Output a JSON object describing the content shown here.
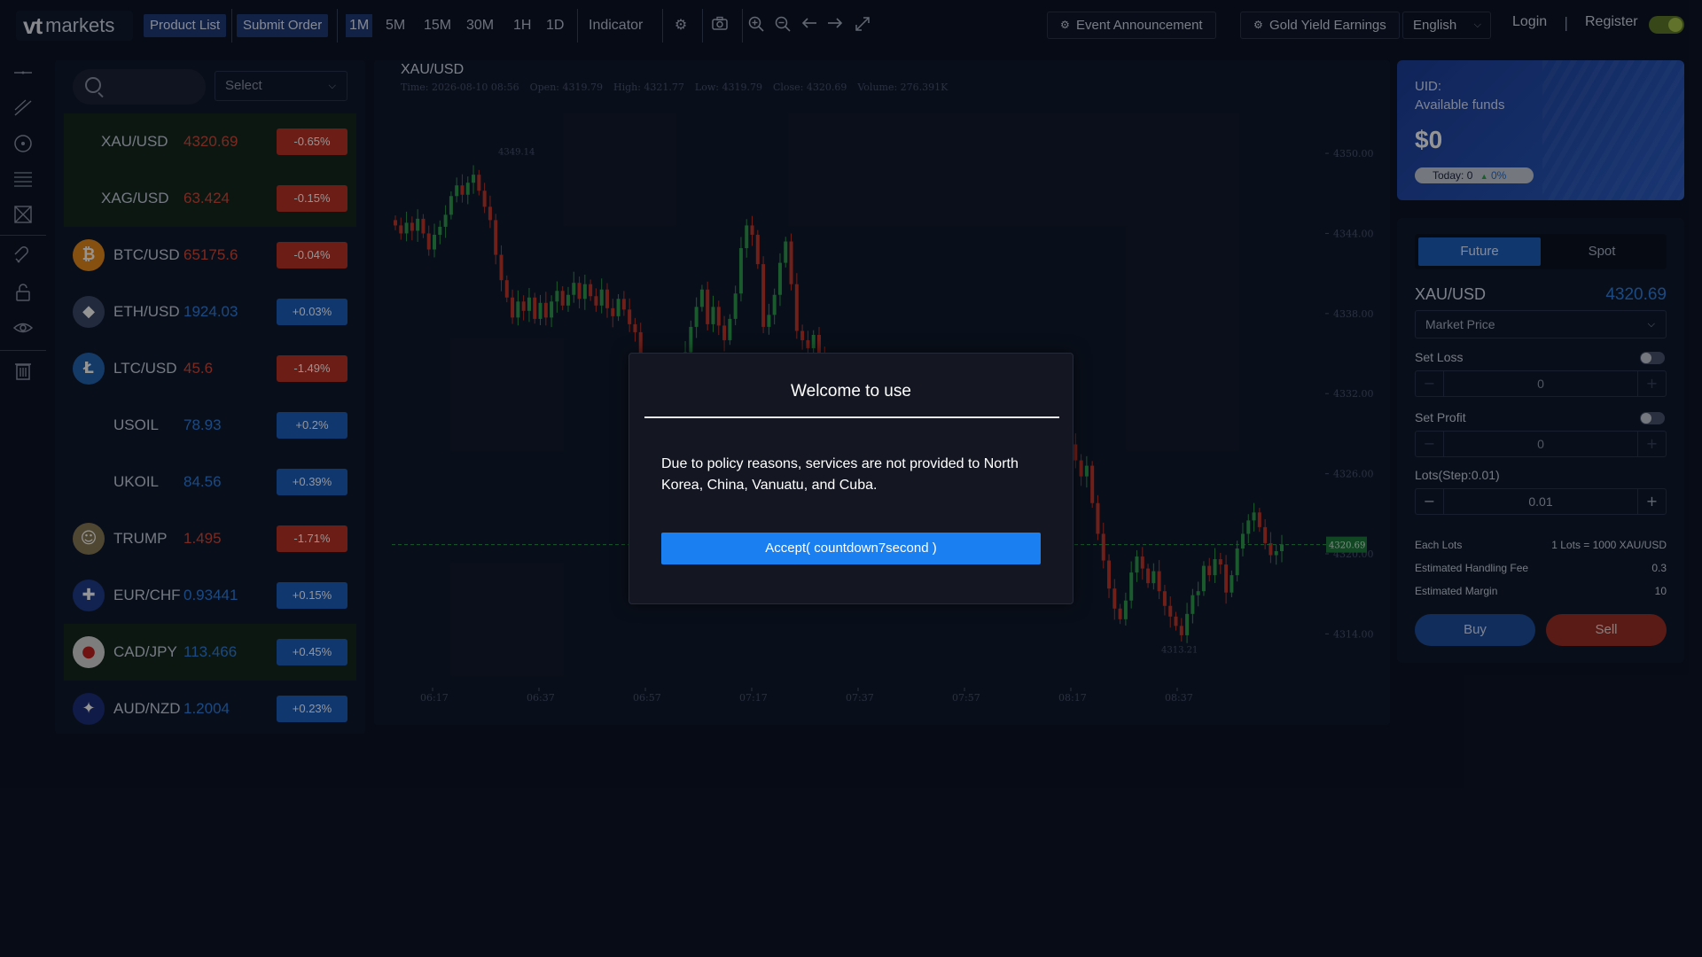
{
  "topbar": {
    "logo_vt": "vt",
    "logo_markets": "markets",
    "product_list": "Product List",
    "submit_order": "Submit Order",
    "timeframes": [
      "1M",
      "5M",
      "15M",
      "30M",
      "1H",
      "1D"
    ],
    "indicator": "Indicator",
    "event_announcement": "Event Announcement",
    "gold_yield": "Gold Yield Earnings",
    "language": "English",
    "login": "Login",
    "separator": "|",
    "register": "Register"
  },
  "product_list": {
    "search_placeholder": "",
    "select_label": "Select",
    "items": [
      {
        "symbol": "XAU/USD",
        "price": "4320.69",
        "change": "-0.65%",
        "dir": "down",
        "icon": "",
        "highlight": true
      },
      {
        "symbol": "XAG/USD",
        "price": "63.424",
        "change": "-0.15%",
        "dir": "down",
        "icon": "",
        "highlight": true
      },
      {
        "symbol": "BTC/USD",
        "price": "65175.6",
        "change": "-0.04%",
        "dir": "down",
        "icon": "bitcoin-icon",
        "highlight": false
      },
      {
        "symbol": "ETH/USD",
        "price": "1924.03",
        "change": "+0.03%",
        "dir": "up",
        "icon": "ethereum-icon",
        "highlight": false
      },
      {
        "symbol": "LTC/USD",
        "price": "45.6",
        "change": "-1.49%",
        "dir": "down",
        "icon": "litecoin-icon",
        "highlight": false
      },
      {
        "symbol": "USOIL",
        "price": "78.93",
        "change": "+0.2%",
        "dir": "up",
        "icon": "",
        "highlight": false
      },
      {
        "symbol": "UKOIL",
        "price": "84.56",
        "change": "+0.39%",
        "dir": "up",
        "icon": "",
        "highlight": false
      },
      {
        "symbol": "TRUMP",
        "price": "1.495",
        "change": "-1.71%",
        "dir": "down",
        "icon": "trump-coin-icon",
        "highlight": false
      },
      {
        "symbol": "EUR/CHF",
        "price": "0.93441",
        "change": "+0.15%",
        "dir": "up",
        "icon": "eur-chf-flag-icon",
        "highlight": false
      },
      {
        "symbol": "CAD/JPY",
        "price": "113.466",
        "change": "+0.45%",
        "dir": "up",
        "icon": "cad-jpy-flag-icon",
        "highlight": true
      },
      {
        "symbol": "AUD/NZD",
        "price": "1.2004",
        "change": "+0.23%",
        "dir": "up",
        "icon": "aud-nzd-flag-icon",
        "highlight": false
      }
    ]
  },
  "chart": {
    "title": "XAU/USD",
    "time": "Time: 2026-08-10 08:56",
    "open": "Open: 4319.79",
    "high": "High: 4321.77",
    "low": "Low: 4319.79",
    "close": "Close: 4320.69",
    "volume": "Volume: 276.391K",
    "current_price_label": "4320.69",
    "max_label": "4349.14",
    "min_label": "4313.21"
  },
  "chart_data": {
    "type": "candlestick",
    "title": "XAU/USD",
    "y_ticks": [
      "4350.00",
      "4344.00",
      "4338.00",
      "4332.00",
      "4326.00",
      "4320.00",
      "4314.00"
    ],
    "x_ticks": [
      "06:17",
      "06:37",
      "06:57",
      "07:17",
      "07:37",
      "07:57",
      "08:17",
      "08:37"
    ],
    "ylim": [
      4312.5,
      4351
    ],
    "current": 4320.69,
    "close_path": [
      4344.6,
      4344.0,
      4344.8,
      4344.2,
      4345.1,
      4344.0,
      4342.8,
      4343.9,
      4344.5,
      4345.4,
      4346.8,
      4347.6,
      4346.9,
      4347.8,
      4348.4,
      4347.2,
      4346.0,
      4345.0,
      4342.4,
      4340.5,
      4339.2,
      4337.7,
      4338.9,
      4338.2,
      4339.2,
      4337.6,
      4338.8,
      4337.7,
      4338.9,
      4339.7,
      4338.6,
      4339.4,
      4340.3,
      4339.1,
      4340.2,
      4339.3,
      4338.6,
      4339.8,
      4338.4,
      4337.8,
      4339.1,
      4338.3,
      4337.2,
      4336.6,
      4333.1,
      4330.0,
      4327.4,
      4326.2,
      4327.6,
      4330.2,
      4332.8,
      4334.0,
      4335.1,
      4337.0,
      4338.5,
      4339.8,
      4337.2,
      4338.5,
      4337.1,
      4336.0,
      4337.6,
      4339.5,
      4342.9,
      4344.6,
      4343.9,
      4341.7,
      4337.0,
      4337.9,
      4339.4,
      4341.8,
      4343.4,
      4340.2,
      4336.7,
      4336.0,
      4335.4,
      4336.4,
      4334.7,
      4333.6,
      4332.8,
      4333.9,
      4333.2,
      4332.5,
      4330.9,
      4331.7,
      4330.0,
      4331.2,
      4331.0,
      4329.9,
      4330.9,
      4330.1,
      4331.7,
      4331.4,
      4330.3,
      4330.2,
      4330.6,
      4331.2,
      4330.7,
      4330.6,
      4331.9,
      4331.8,
      4330.3,
      4331.5,
      4332.5,
      4331.7,
      4330.6,
      4329.1,
      4327.7,
      4326.0,
      4325.4,
      4323.9,
      4322.3,
      4321.7,
      4323.2,
      4324.5,
      4322.9,
      4321.8,
      4322.8,
      4323.2,
      4324.2,
      4325.9,
      4327.6,
      4328.2,
      4327.0,
      4325.8,
      4326.6,
      4323.8,
      4321.5,
      4319.5,
      4317.4,
      4315.9,
      4315.1,
      4316.5,
      4318.6,
      4319.8,
      4318.9,
      4317.8,
      4318.7,
      4317.2,
      4316.1,
      4315.3,
      4314.6,
      4313.9,
      4315.5,
      4316.9,
      4317.2,
      4319.1,
      4318.4,
      4319.6,
      4319.2,
      4317.1,
      4318.4,
      4320.4,
      4321.5,
      4322.5,
      4323.1,
      4322.0,
      4320.8,
      4319.9,
      4320.2,
      4320.7
    ]
  },
  "account": {
    "uid_label": "UID:",
    "available_funds": "Available funds",
    "balance": "$0",
    "today_label": "Today: 0",
    "today_pct": "0%"
  },
  "order": {
    "tab_future": "Future",
    "tab_spot": "Spot",
    "pair": "XAU/USD",
    "price": "4320.69",
    "order_type": "Market Price",
    "set_loss": "Set Loss",
    "loss_value": "0",
    "set_profit": "Set Profit",
    "profit_value": "0",
    "lots_label": "Lots(Step:0.01)",
    "lots_value": "0.01",
    "each_lots_label": "Each Lots",
    "each_lots_value": "1 Lots = 1000 XAU/USD",
    "fee_label": "Estimated Handling Fee",
    "fee_value": "0.3",
    "margin_label": "Estimated Margin",
    "margin_value": "10",
    "buy": "Buy",
    "sell": "Sell"
  },
  "modal": {
    "title": "Welcome to use",
    "body": "Due to policy reasons, services are not provided to North Korea, China, Vanuatu, and Cuba.",
    "accept": "Accept( countdown7second )"
  },
  "colors": {
    "up": "#2d9b4e",
    "down": "#c2362b",
    "accent": "#1a7ff0"
  }
}
